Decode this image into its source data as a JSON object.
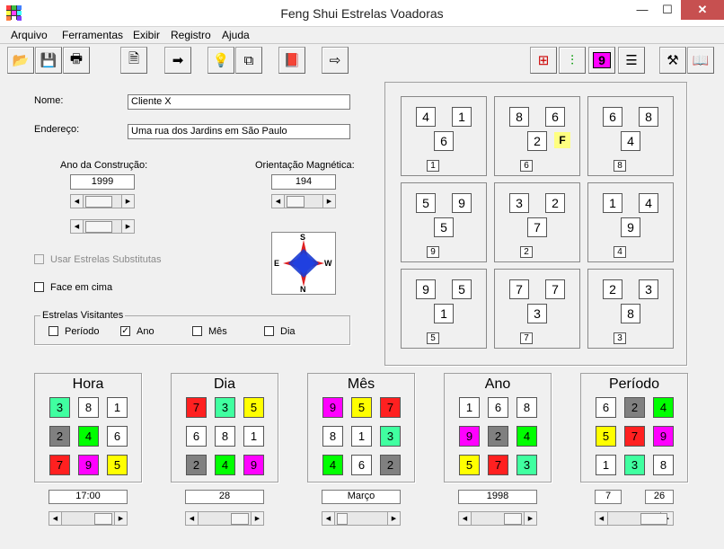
{
  "window": {
    "title": "Feng Shui Estrelas Voadoras",
    "minimize": "—",
    "maximize": "☐",
    "close": "✕"
  },
  "menu": [
    "Arquivo",
    "Ferramentas",
    "Exibir",
    "Registro",
    "Ajuda"
  ],
  "toolbar": [
    {
      "name": "open-icon",
      "glyph": "📂"
    },
    {
      "name": "save-icon",
      "glyph": "💾"
    },
    {
      "name": "print-icon",
      "glyph": "🖶"
    },
    {
      "name": "properties-icon",
      "glyph": "🗎"
    },
    {
      "name": "arrow-right-icon",
      "glyph": "➡"
    },
    {
      "name": "light-bulb-icon",
      "glyph": "💡"
    },
    {
      "name": "layout-icon",
      "glyph": "⧉"
    },
    {
      "name": "book-red-icon",
      "glyph": "📕"
    },
    {
      "name": "export-icon",
      "glyph": "⇨"
    },
    {
      "name": "grid-icon",
      "glyph": "⊞"
    },
    {
      "name": "bars-icon",
      "glyph": "⫶"
    },
    {
      "name": "nine-icon",
      "glyph": "9"
    },
    {
      "name": "lines-icon",
      "glyph": "☰"
    },
    {
      "name": "tools-icon",
      "glyph": "⚒"
    },
    {
      "name": "book-icon",
      "glyph": "📖"
    }
  ],
  "form": {
    "name_label": "Nome:",
    "name_value": "Cliente X",
    "address_label": "Endereço:",
    "address_value": "Uma rua dos Jardins em São Paulo",
    "year_label": "Ano da Construção:",
    "year_value": "1999",
    "orientation_label": "Orientação Magnética:",
    "orientation_value": "194",
    "substitute_label": "Usar Estrelas Substitutas",
    "face_up_label": "Face em cima",
    "compass": {
      "n": "N",
      "s": "S",
      "e": "E",
      "w": "W"
    }
  },
  "visiting": {
    "title": "Estrelas Visitantes",
    "options": [
      {
        "label": "Período",
        "checked": false
      },
      {
        "label": "Ano",
        "checked": true
      },
      {
        "label": "Mês",
        "checked": false
      },
      {
        "label": "Dia",
        "checked": false
      }
    ]
  },
  "chart": [
    {
      "a": "4",
      "b": "1",
      "c": "6",
      "d": "1",
      "f": ""
    },
    {
      "a": "8",
      "b": "6",
      "c": "2",
      "d": "6",
      "f": "F"
    },
    {
      "a": "6",
      "b": "8",
      "c": "4",
      "d": "8",
      "f": ""
    },
    {
      "a": "5",
      "b": "9",
      "c": "5",
      "d": "9",
      "f": ""
    },
    {
      "a": "3",
      "b": "2",
      "c": "7",
      "d": "2",
      "f": ""
    },
    {
      "a": "1",
      "b": "4",
      "c": "9",
      "d": "4",
      "f": ""
    },
    {
      "a": "9",
      "b": "5",
      "c": "1",
      "d": "5",
      "f": ""
    },
    {
      "a": "7",
      "b": "7",
      "c": "3",
      "d": "7",
      "f": ""
    },
    {
      "a": "2",
      "b": "3",
      "c": "8",
      "d": "3",
      "f": ""
    }
  ],
  "colors": {
    "1": "#ffffff",
    "2": "#808080",
    "3": "#40ffa0",
    "4": "#00ff00",
    "5": "#ffff00",
    "6": "#ffffff",
    "7": "#ff2020",
    "8": "#ffffff",
    "9": "#ff00ff",
    "F": "#ffff80"
  },
  "panels": [
    {
      "title": "Hora",
      "grid": [
        "3",
        "8",
        "1",
        "2",
        "4",
        "6",
        "7",
        "9",
        "5"
      ],
      "value": "17:00"
    },
    {
      "title": "Dia",
      "grid": [
        "7",
        "3",
        "5",
        "6",
        "8",
        "1",
        "2",
        "4",
        "9"
      ],
      "value": "28"
    },
    {
      "title": "Mês",
      "grid": [
        "9",
        "5",
        "7",
        "8",
        "1",
        "3",
        "4",
        "6",
        "2"
      ],
      "value": "Março"
    },
    {
      "title": "Ano",
      "grid": [
        "1",
        "6",
        "8",
        "9",
        "2",
        "4",
        "5",
        "7",
        "3"
      ],
      "value": "1998"
    },
    {
      "title": "Período",
      "grid": [
        "6",
        "2",
        "4",
        "5",
        "7",
        "9",
        "1",
        "3",
        "8"
      ],
      "value": "7",
      "value2": "26"
    }
  ]
}
